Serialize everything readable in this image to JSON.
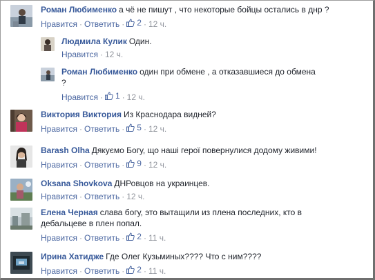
{
  "labels": {
    "like": "Нравится",
    "reply": "Ответить",
    "separator": "·"
  },
  "comments": [
    {
      "author": "Роман Любименко",
      "text": "а чё не пишут , что некоторые бойцы остались в днр ?",
      "likes": "2",
      "time": "12 ч.",
      "avatar": "avatar-roman"
    },
    {
      "author": "Людмила Кулик",
      "text": "Один.",
      "time": "12 ч.",
      "avatar": "avatar-ludmila"
    },
    {
      "author": "Роман Любименко",
      "text": "один при обмене , а отказавшиеся до обмена",
      "text2": "?",
      "likes": "1",
      "time": "12 ч.",
      "avatar": "avatar-roman"
    },
    {
      "author": "Виктория Виктория",
      "text": "Из Краснодара видней?",
      "likes": "5",
      "time": "12 ч.",
      "avatar": "avatar-viktoria"
    },
    {
      "author": "Barash Olha",
      "text": "Дякуємо Богу, що наші герої повернулися додому живими!",
      "likes": "9",
      "time": "12 ч.",
      "avatar": "avatar-barash"
    },
    {
      "author": "Oksana Shovkova",
      "text": "ДНРовцов на украинцев.",
      "time": "12 ч.",
      "avatar": "avatar-oksana"
    },
    {
      "author": "Елена Черная",
      "text": "слава богу, это вытащили из плена последних, кто в",
      "text2": "дебальцеве в плен попал.",
      "likes": "2",
      "time": "11 ч.",
      "avatar": "avatar-elena"
    },
    {
      "author": "Ирина Хатидже",
      "text": "Где Олег Кузьминых???? Что с ним????",
      "likes": "2",
      "time": "11 ч.",
      "avatar": "avatar-irina"
    }
  ],
  "colors": {
    "author": "#365899",
    "link": "#4b67a1",
    "meta": "#90949c",
    "text": "#1d2129"
  }
}
